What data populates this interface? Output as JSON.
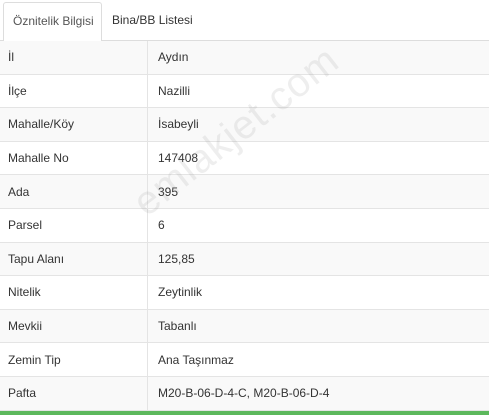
{
  "tabs": {
    "active_label": "Öznitelik Bilgisi",
    "inactive_label": "Bina/BB Listesi"
  },
  "rows": [
    {
      "label": "İl",
      "value": "Aydın"
    },
    {
      "label": "İlçe",
      "value": "Nazilli"
    },
    {
      "label": "Mahalle/Köy",
      "value": "İsabeyli"
    },
    {
      "label": "Mahalle No",
      "value": "147408"
    },
    {
      "label": "Ada",
      "value": "395"
    },
    {
      "label": "Parsel",
      "value": "6"
    },
    {
      "label": "Tapu Alanı",
      "value": "125,85"
    },
    {
      "label": "Nitelik",
      "value": "Zeytinlik"
    },
    {
      "label": "Mevkii",
      "value": "Tabanlı"
    },
    {
      "label": "Zemin Tip",
      "value": "Ana Taşınmaz"
    },
    {
      "label": "Pafta",
      "value": "M20-B-06-D-4-C, M20-B-06-D-4"
    }
  ],
  "watermark": "emlakjet.com",
  "colors": {
    "accent_bar": "#5cb85c",
    "row_stripe": "#f9f9f9",
    "border": "#e4e4e4"
  }
}
